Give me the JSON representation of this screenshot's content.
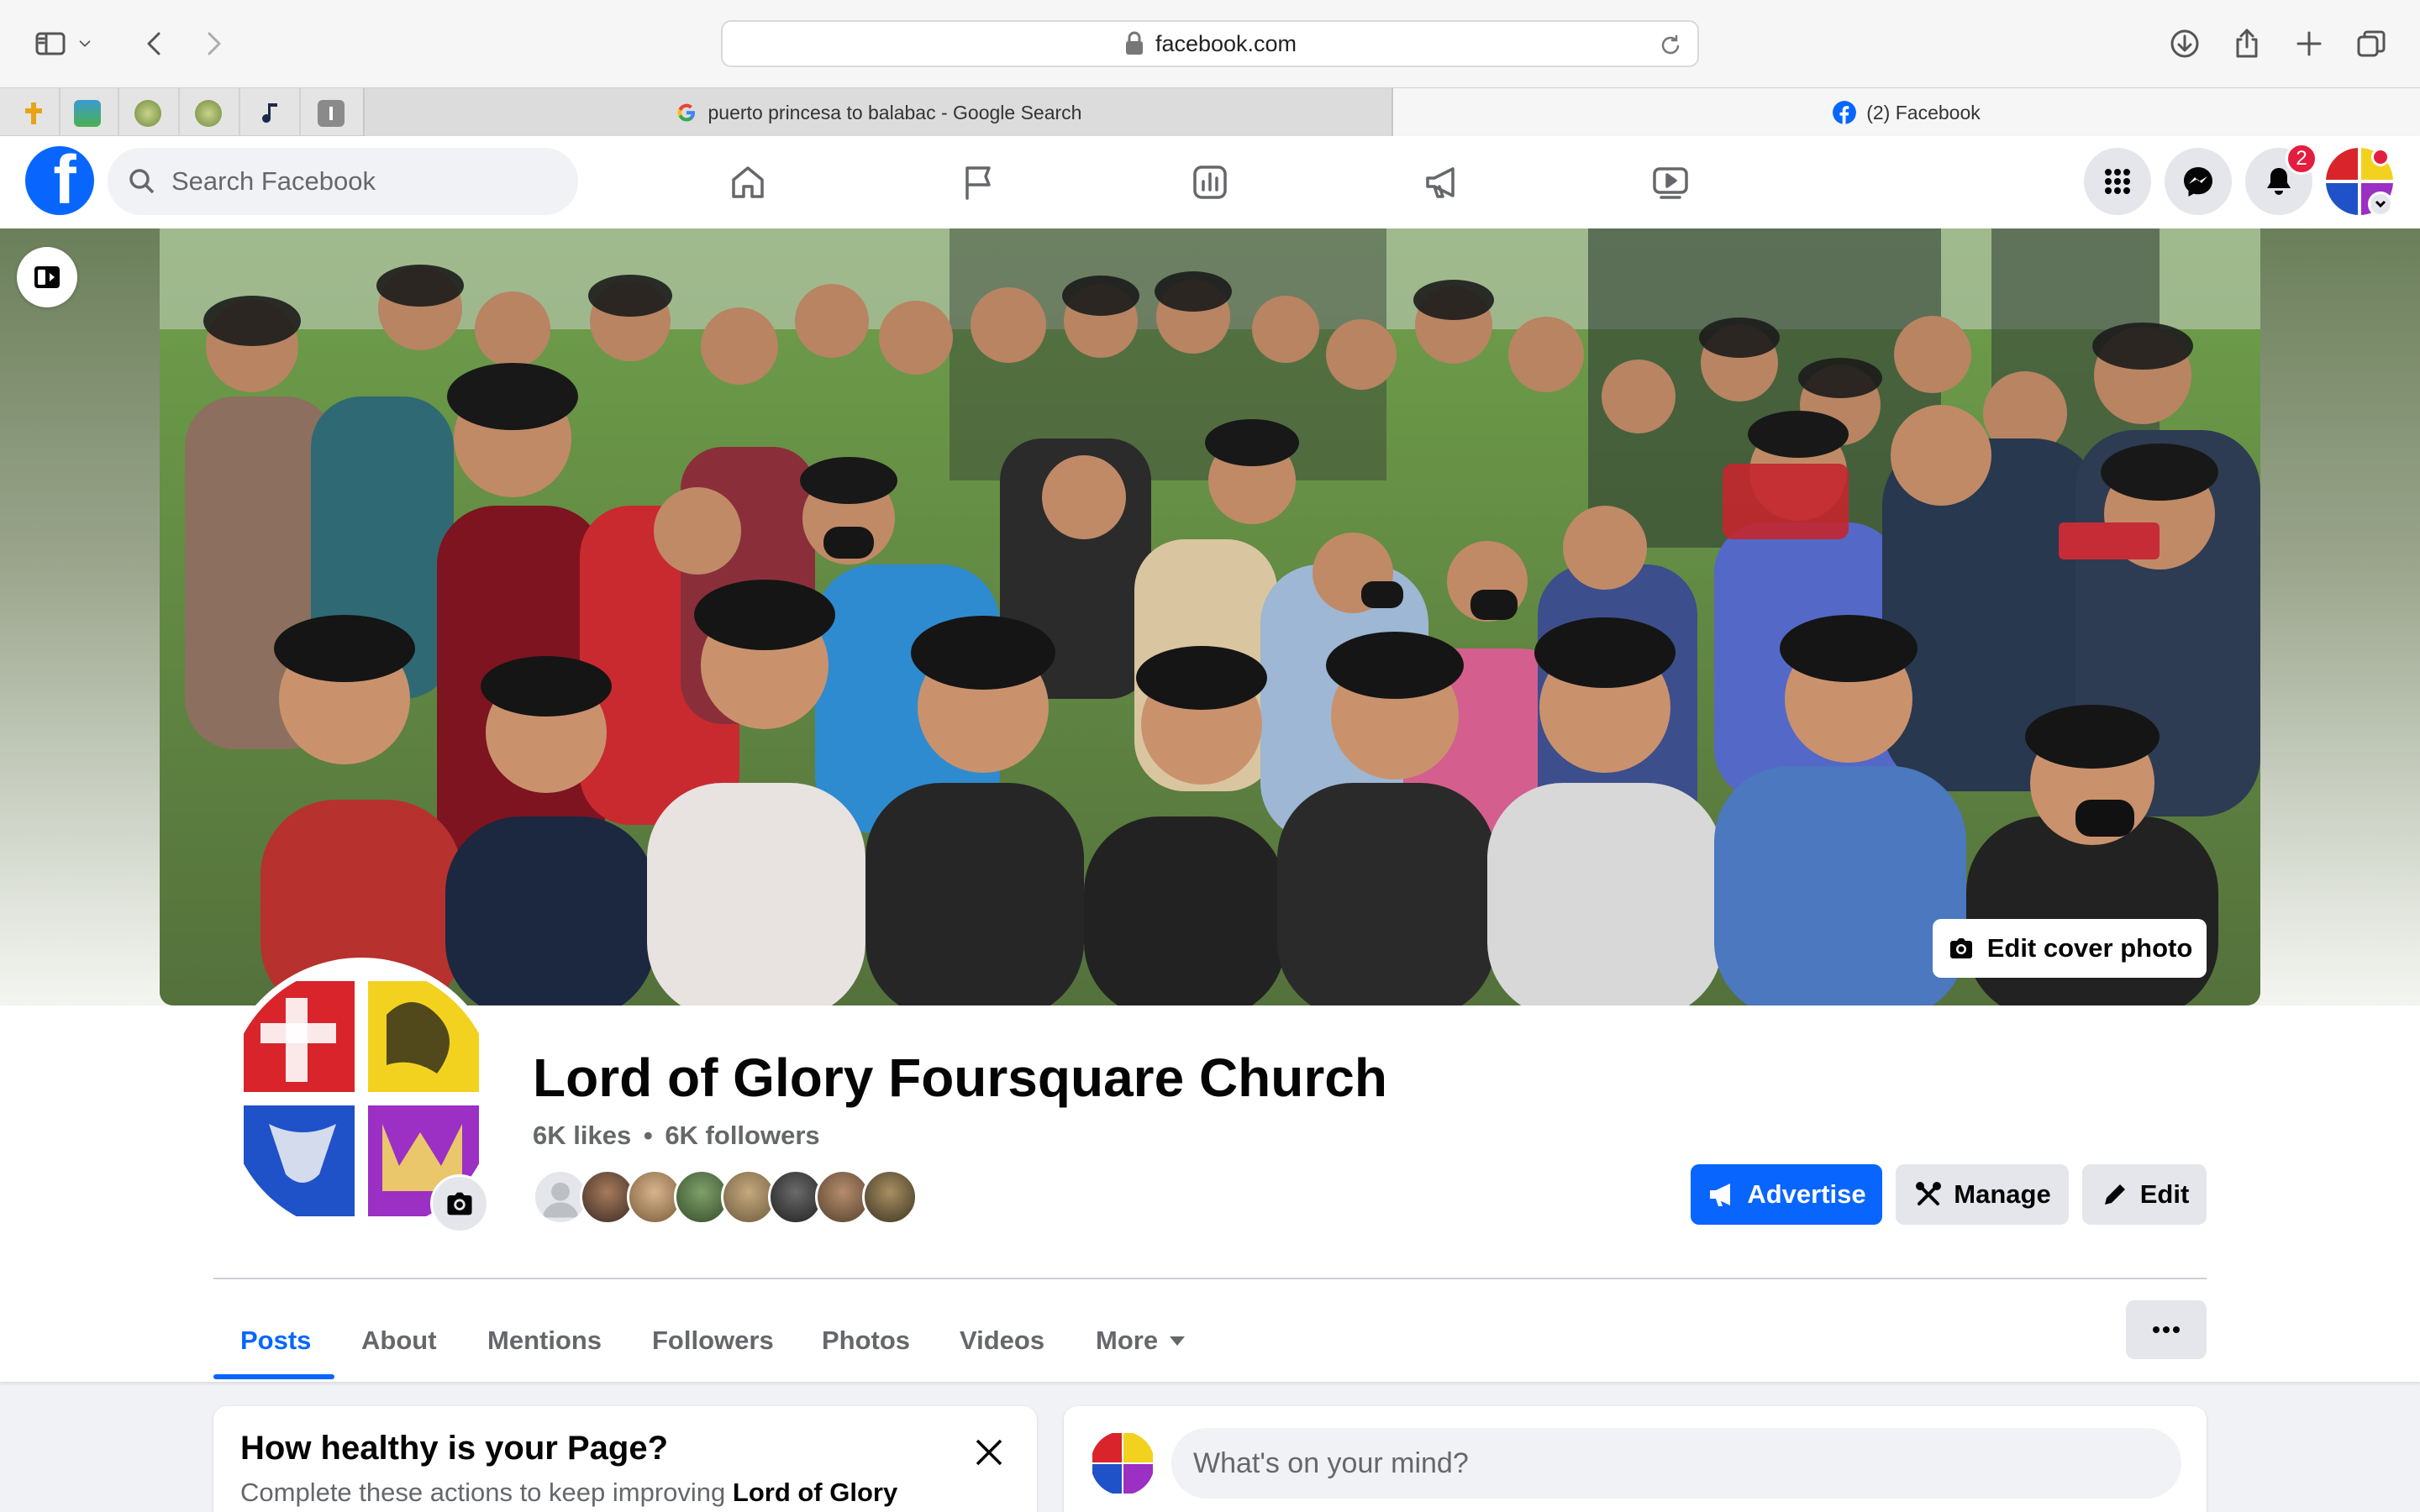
{
  "browser": {
    "url": "facebook.com",
    "tabs": [
      {
        "title": "puerto princesa to balabac - Google Search",
        "active": false
      },
      {
        "title": "(2) Facebook",
        "active": true
      }
    ]
  },
  "fb_nav": {
    "search_placeholder": "Search Facebook",
    "notification_count": "2"
  },
  "page": {
    "title": "Lord of Glory Foursquare Church",
    "likes": "6K likes",
    "separator": "•",
    "followers": "6K followers",
    "edit_cover_label": "Edit cover photo",
    "actions": {
      "advertise": "Advertise",
      "manage": "Manage",
      "edit": "Edit"
    },
    "tabs": [
      {
        "label": "Posts",
        "active": true
      },
      {
        "label": "About",
        "active": false
      },
      {
        "label": "Mentions",
        "active": false
      },
      {
        "label": "Followers",
        "active": false
      },
      {
        "label": "Photos",
        "active": false
      },
      {
        "label": "Videos",
        "active": false
      },
      {
        "label": "More",
        "active": false
      }
    ]
  },
  "health_card": {
    "title": "How healthy is your Page?",
    "subtitle": "Complete these actions to keep improving",
    "subtitle_bold": "Lord of Glory"
  },
  "composer": {
    "placeholder": "What's on your mind?"
  },
  "colors": {
    "brand_blue": "#0866ff",
    "badge_red": "#e41e3f",
    "logo_red": "#d8242a",
    "logo_yellow": "#f2d21e",
    "logo_blue": "#1f52c8",
    "logo_purple": "#9c2fc4"
  }
}
